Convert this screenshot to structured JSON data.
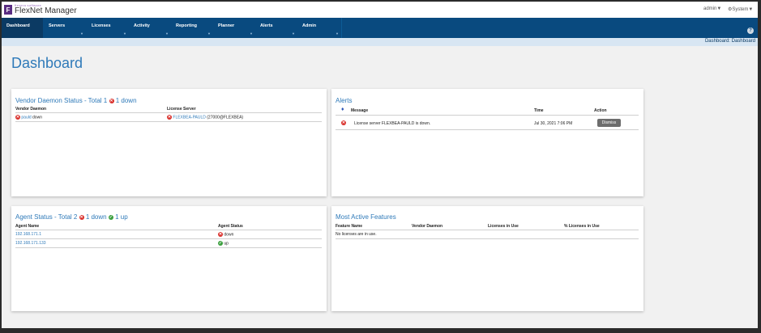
{
  "app": {
    "logo_small": "flexera software",
    "title": "FlexNet Manager",
    "user_menu": "admin",
    "system_menu": "System",
    "breadcrumb": "Dashboard: Dashboard",
    "page_title": "Dashboard"
  },
  "nav": [
    {
      "label": "Dashboard",
      "active": true
    },
    {
      "label": "Servers"
    },
    {
      "label": "Licenses"
    },
    {
      "label": "Activity"
    },
    {
      "label": "Reporting"
    },
    {
      "label": "Planner"
    },
    {
      "label": "Alerts"
    },
    {
      "label": "Admin"
    }
  ],
  "vendor_panel": {
    "title": "Vendor Daemon Status - Total 1",
    "down_text": "1 down",
    "col_daemon": "Vendor Daemon",
    "col_server": "License Server",
    "rows": [
      {
        "daemon": "pauld",
        "status": "down",
        "server_link": "FLEXBEA-PAULD",
        "server_port": "(27000@FLEXBEA)"
      }
    ]
  },
  "alerts_panel": {
    "title": "Alerts",
    "col_message": "Message",
    "col_time": "Time",
    "col_action": "Action",
    "rows": [
      {
        "message": "License server FLEXBEA-PAULD is down.",
        "time": "Jul 30, 2021 7:06 PM",
        "action": "Dismiss"
      }
    ]
  },
  "agent_panel": {
    "title": "Agent Status - Total 2",
    "down_text": "1 down",
    "up_text": "1 up",
    "col_name": "Agent Name",
    "col_status": "Agent Status",
    "rows": [
      {
        "name": "192.168.171.1",
        "status": "down"
      },
      {
        "name": "192.168.171.133",
        "status": "up"
      }
    ]
  },
  "features_panel": {
    "title": "Most Active Features",
    "col_feature": "Feature Name",
    "col_daemon": "Vendor Daemon",
    "col_in_use": "Licenses in Use",
    "col_pct": "% Licenses in Use",
    "empty_text": "No licenses are in use."
  },
  "colors": {
    "nav_bg": "#094a7f",
    "accent": "#2f7ab9",
    "error": "#d9302c",
    "ok": "#3b9f3e"
  }
}
